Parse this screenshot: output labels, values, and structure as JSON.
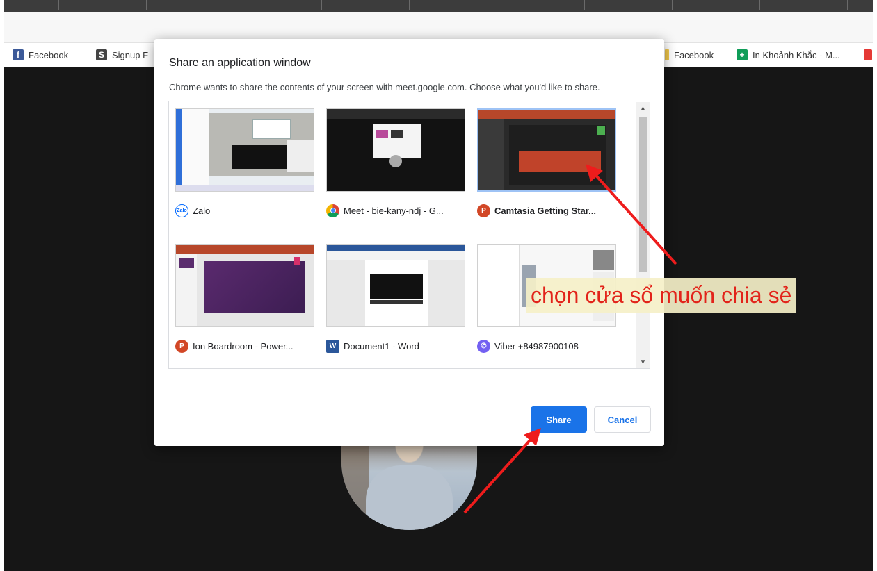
{
  "bookmarks": [
    {
      "label": "Facebook",
      "icon": "facebook-icon",
      "color": "#3b5998",
      "glyph": "f"
    },
    {
      "label": "Signup F",
      "icon": "signup-icon",
      "color": "#444444",
      "glyph": "S"
    },
    {
      "label": "Facebook",
      "icon": "folder-icon",
      "color": "#f2c94c",
      "glyph": ""
    },
    {
      "label": "In Khoảnh Khắc - M...",
      "icon": "sheets-icon",
      "color": "#0f9d58",
      "glyph": "+"
    },
    {
      "label": "",
      "icon": "red-app-icon",
      "color": "#e53935",
      "glyph": ""
    }
  ],
  "dialog": {
    "title": "Share an application window",
    "description": "Chrome wants to share the contents of your screen with meet.google.com. Choose what you'd like to share.",
    "windows": [
      {
        "label": "Zalo",
        "icon": "zalo-icon",
        "icon_text": "Zalo",
        "icon_color": "#0068ff",
        "selected": false
      },
      {
        "label": "Meet - bie-kany-ndj - G...",
        "icon": "chrome-icon",
        "icon_text": "",
        "icon_color": "#db4437",
        "selected": false
      },
      {
        "label": "Camtasia Getting Star...",
        "icon": "powerpoint-icon",
        "icon_text": "P",
        "icon_color": "#d24726",
        "selected": true
      },
      {
        "label": "Ion Boardroom - Power...",
        "icon": "powerpoint-icon",
        "icon_text": "P",
        "icon_color": "#d24726",
        "selected": false
      },
      {
        "label": "Document1 - Word",
        "icon": "word-icon",
        "icon_text": "W",
        "icon_color": "#2b579a",
        "selected": false
      },
      {
        "label": "Viber +84987900108",
        "icon": "viber-icon",
        "icon_text": "✆",
        "icon_color": "#7360f2",
        "selected": false
      }
    ],
    "share_label": "Share",
    "cancel_label": "Cancel"
  },
  "annotation": {
    "text": "chọn cửa sổ muốn chia sẻ",
    "color": "#e2231a"
  }
}
